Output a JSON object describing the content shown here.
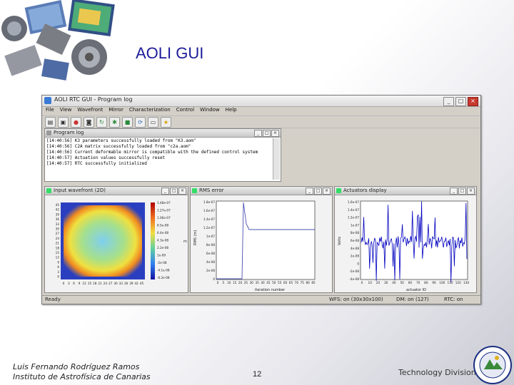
{
  "slide": {
    "title": "AOLI GUI",
    "author": "Luis Fernando Rodríguez Ramos",
    "institution": "Instituto de Astrofísica de Canarias",
    "page_number": "12",
    "division": "Technology Division"
  },
  "window": {
    "title": "AOLI RTC GUI - Program log",
    "menu": [
      "File",
      "View",
      "Wavefront",
      "Mirror",
      "Characterization",
      "Control",
      "Window",
      "Help"
    ],
    "toolbar_icons": [
      "folder-icon",
      "save-icon",
      "record-icon",
      "camera-icon",
      "refresh-icon",
      "settings-icon",
      "stop-icon",
      "sync-icon",
      "monitor-icon",
      "star-icon"
    ]
  },
  "program_log": {
    "title": "Program log",
    "lines": [
      "[14:40:56] K3 parameters successfully loaded from \"K3.aom\"",
      "[14:40:56] C2A matrix successfully loaded from \"c2a.aom\"",
      "[14:40:56] Current deformable mirror is compatible with the defined control system",
      "[14:40:57] Actuation values successfully reset",
      "[14:40:57] RTC successfully initialized"
    ]
  },
  "panels": {
    "wavefront": {
      "title": "Input wavefront (2D)",
      "colorbar_labels": [
        "1.48e-07",
        "1.27e-07",
        "1.06e-07",
        "8.5e-08",
        "6.4e-08",
        "4.3e-08",
        "2.2e-08",
        "1e-09",
        "-2e-08",
        "-4.1e-08",
        "-6.2e-08"
      ],
      "colorbar_unit": "m",
      "x_ticks": [
        "0",
        "3",
        "6",
        "9",
        "12",
        "15",
        "18",
        "21",
        "24",
        "27",
        "30",
        "33",
        "36",
        "39",
        "42",
        "45"
      ],
      "y_ticks": [
        "45",
        "42",
        "39",
        "36",
        "33",
        "30",
        "27",
        "24",
        "21",
        "18",
        "15",
        "12",
        "9",
        "6",
        "3",
        "0"
      ]
    },
    "rms": {
      "title": "RMS error",
      "ylabel": "RMS (m)",
      "xlabel": "iteration number",
      "y_ticks": [
        "1.8e-07",
        "1.6e-07",
        "1.4e-07",
        "1.2e-07",
        "1e-07",
        "8e-08",
        "6e-08",
        "4e-08",
        "2e-08",
        "0"
      ],
      "x_ticks": [
        "0",
        "5",
        "10",
        "15",
        "20",
        "25",
        "30",
        "35",
        "40",
        "45",
        "50",
        "55",
        "60",
        "65",
        "70",
        "75",
        "80",
        "85"
      ]
    },
    "actuators": {
      "title": "Actuators display",
      "ylabel": "Volts",
      "xlabel": "actuator ID",
      "y_ticks": [
        "1.6e-07",
        "1.4e-07",
        "1.2e-07",
        "1e-07",
        "8e-08",
        "6e-08",
        "4e-08",
        "2e-08",
        "0",
        "-2e-08",
        "-4e-08"
      ],
      "x_ticks": [
        "0",
        "10",
        "20",
        "30",
        "40",
        "50",
        "60",
        "70",
        "80",
        "90",
        "100",
        "110",
        "120",
        "130"
      ]
    }
  },
  "statusbar": {
    "left": "Ready",
    "wfs": "WFS: on (30x30x100)",
    "dm": "DM: on (127)",
    "rtc": "RTC: on"
  },
  "colors": {
    "title": "#1c1c9a",
    "series_blue": "#0000c0"
  }
}
